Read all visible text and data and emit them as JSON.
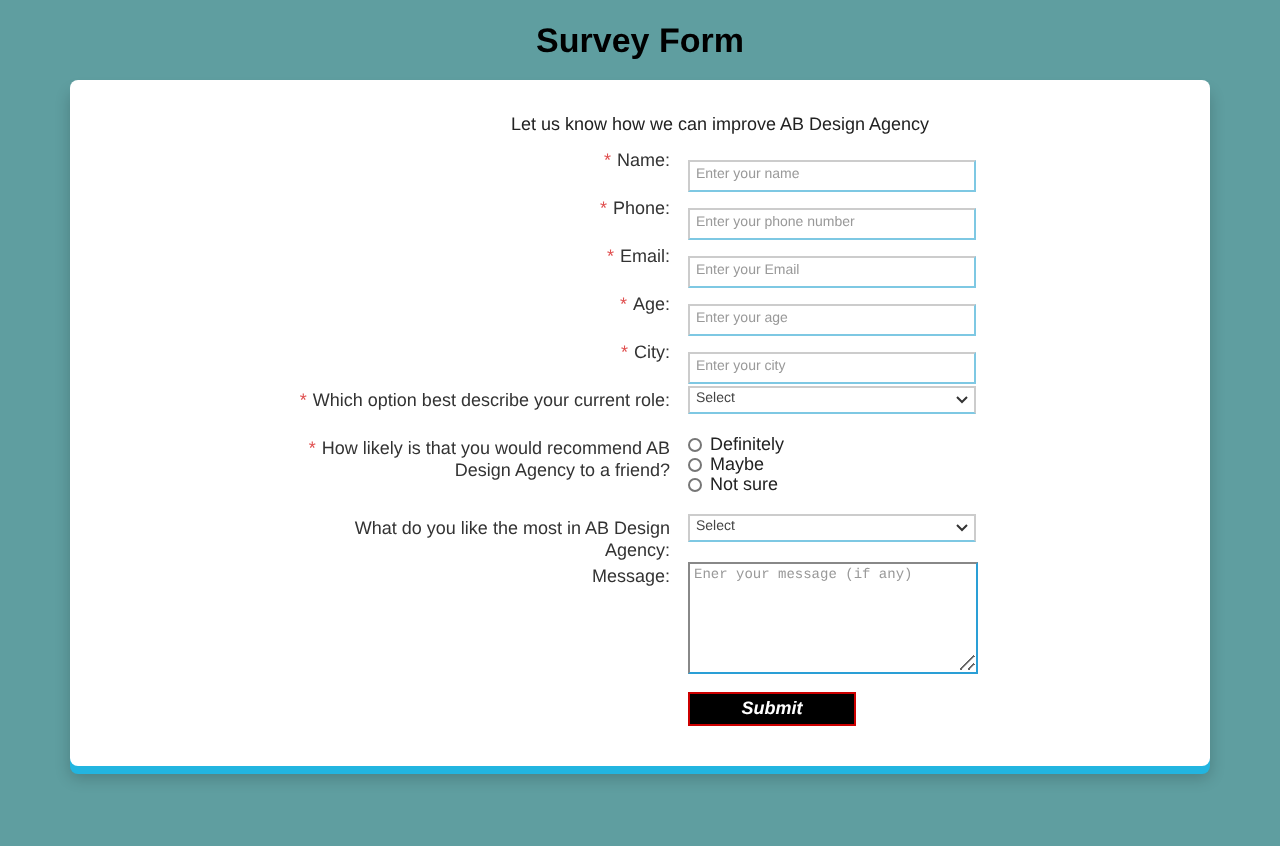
{
  "title": "Survey Form",
  "intro": "Let us know how we can improve AB Design Agency",
  "fields": [
    {
      "kind": "text",
      "mark": "*",
      "label": "Name:",
      "placeholder": "Enter your name"
    },
    {
      "kind": "text",
      "mark": "*",
      "label": "Phone:",
      "placeholder": "Enter your phone number"
    },
    {
      "kind": "text",
      "mark": "*",
      "label": "Email:",
      "placeholder": "Enter your Email"
    },
    {
      "kind": "text",
      "mark": "*",
      "label": "Age:",
      "placeholder": "Enter your age"
    },
    {
      "kind": "text",
      "mark": "*",
      "label": "City:",
      "placeholder": "Enter your city"
    },
    {
      "kind": "select",
      "mark": "*",
      "label": "Which option best describe your current role:",
      "value": "Select"
    },
    {
      "kind": "radio",
      "mark": "*",
      "label": "How likely is that you would recommend AB Design Agency to a friend?",
      "options": [
        {
          "label": "Definitely",
          "selected": false
        },
        {
          "label": "Maybe",
          "selected": false
        },
        {
          "label": "Not sure",
          "selected": false
        }
      ]
    },
    {
      "kind": "select",
      "label": "What do you like the most in AB Design Agency:",
      "value": "Select"
    },
    {
      "kind": "textarea",
      "label": "Message:",
      "placeholder": "Ener your message (if any)"
    }
  ],
  "submit": "Submit"
}
